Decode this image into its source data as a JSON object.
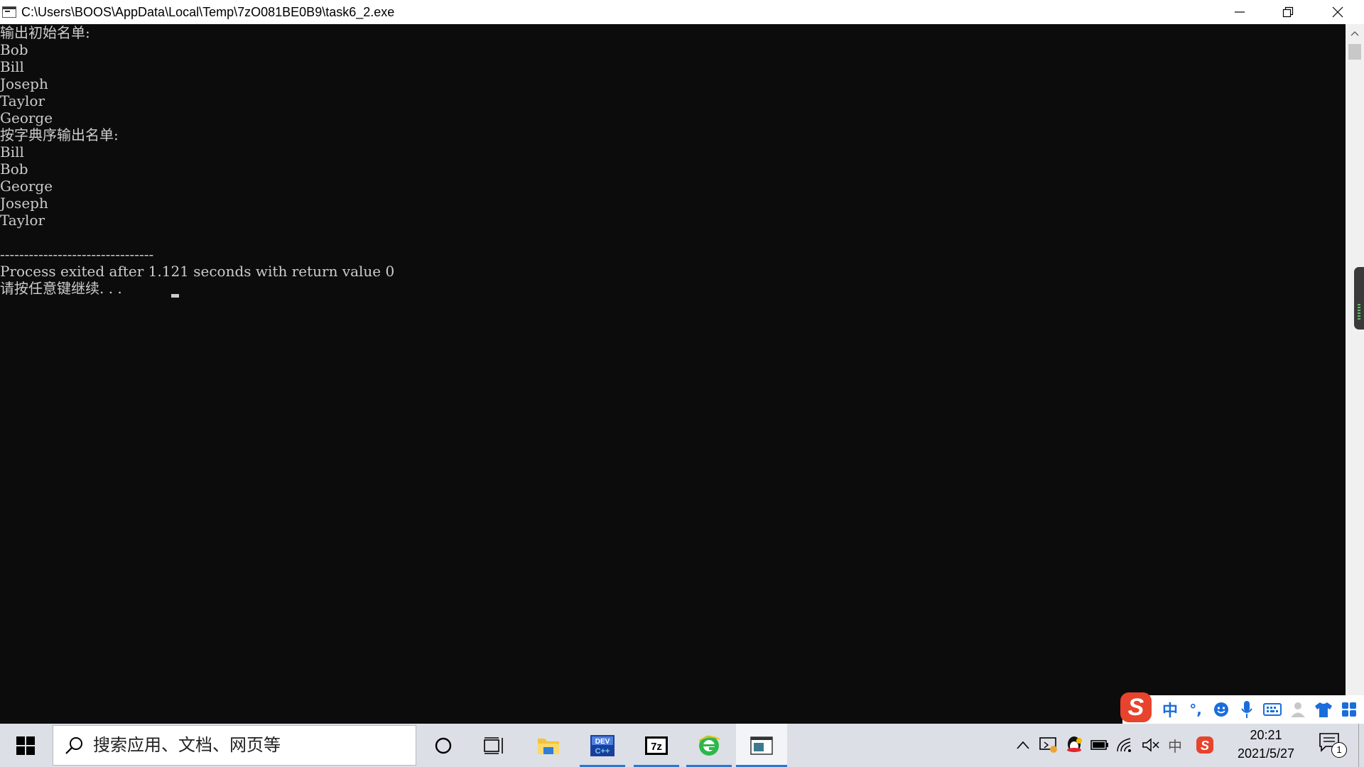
{
  "window": {
    "title": "C:\\Users\\BOOS\\AppData\\Local\\Temp\\7zO081BE0B9\\task6_2.exe"
  },
  "console": {
    "lines": [
      "输出初始名单:",
      "Bob",
      "Bill",
      "Joseph",
      "Taylor",
      "George",
      "按字典序输出名单:",
      "Bill",
      "Bob",
      "George",
      "Joseph",
      "Taylor",
      "",
      "--------------------------------",
      "Process exited after 1.121 seconds with return value 0",
      "请按任意键继续. . ."
    ]
  },
  "ime": {
    "logo": "S",
    "mode": "中",
    "punct": "°,"
  },
  "taskbar": {
    "search_placeholder": "搜索应用、文档、网页等",
    "tray_lang": "中",
    "time": "20:21",
    "date": "2021/5/27",
    "notification_count": "1"
  },
  "colors": {
    "console_bg": "#0c0c0c",
    "console_fg": "#cccccc",
    "taskbar_bg": "#dcdfe6",
    "accent": "#2b78d4",
    "ime_red": "#e8432c"
  }
}
